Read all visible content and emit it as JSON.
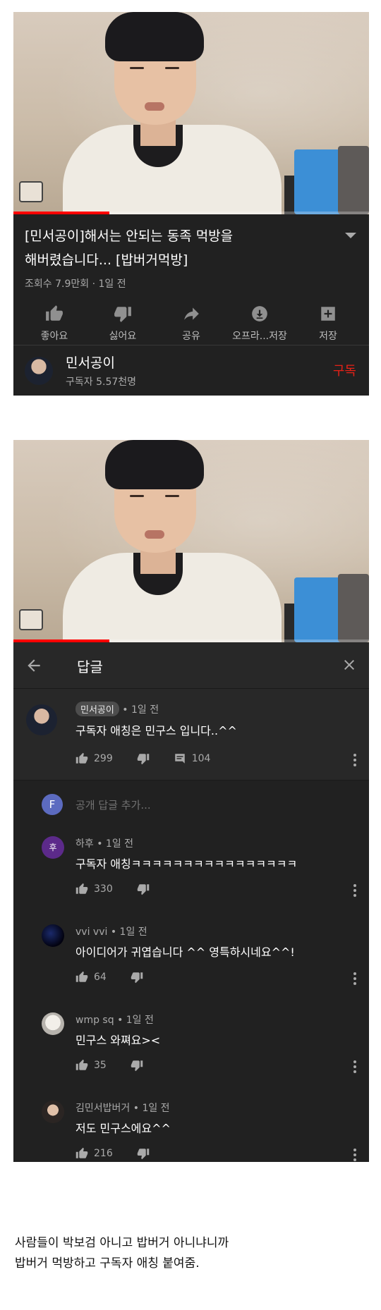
{
  "video": {
    "title_line1": "[민서공이]해서는 안되는 동족 먹방을",
    "title_line2": "해버렸습니다... [밥버거먹방]",
    "meta": "조회수 7.9만회 · 1일 전",
    "progress": 0.27,
    "actions": [
      {
        "icon": "thumb-up-icon",
        "label": "좋아요"
      },
      {
        "icon": "thumb-down-icon",
        "label": "싫어요"
      },
      {
        "icon": "share-icon",
        "label": "공유"
      },
      {
        "icon": "download-icon",
        "label": "오프라...저장"
      },
      {
        "icon": "playlist-add-icon",
        "label": "저장"
      }
    ]
  },
  "channel": {
    "name": "민서공이",
    "subscribers": "구독자 5.57천명",
    "subscribe_label": "구독"
  },
  "replies_panel": {
    "header_title": "답글",
    "back_icon": "arrow-left-icon",
    "close_icon": "close-icon",
    "parent_comment": {
      "author": "민서공이",
      "time": "• 1일 전",
      "text": "구독자 애칭은 민구스 입니다..^^",
      "likes": "299",
      "replies": "104"
    },
    "add_reply": {
      "avatar_letter": "F",
      "placeholder": "공개 답글 추가..."
    },
    "replies": [
      {
        "author": "하후",
        "time": "• 1일 전",
        "text": "구독자 애칭ㅋㅋㅋㅋㅋㅋㅋㅋㅋㅋㅋㅋㅋㅋㅋㅋ",
        "likes": "330",
        "avatar_text": "후"
      },
      {
        "author": "vvi vvi",
        "time": "• 1일 전",
        "text": "아이디어가 귀엽습니다 ^^ 영특하시네요^^!",
        "likes": "64",
        "avatar_text": ""
      },
      {
        "author": "wmp sq",
        "time": "• 1일 전",
        "text": "민구스 와쪄요><",
        "likes": "35",
        "avatar_text": ""
      },
      {
        "author": "김민서밥버거",
        "time": "• 1일 전",
        "text": "저도 민구스에요^^",
        "likes": "216",
        "avatar_text": ""
      }
    ]
  },
  "caption": {
    "line1": "사람들이 박보검 아니고 밥버거 아니냐니까",
    "line2": "밥버거 먹방하고 구독자 애칭 붙여줌."
  },
  "colors": {
    "dark_bg": "#212121",
    "panel_bg": "#282828",
    "subscribe_red": "#e62117",
    "progress_red": "#ff0000"
  }
}
